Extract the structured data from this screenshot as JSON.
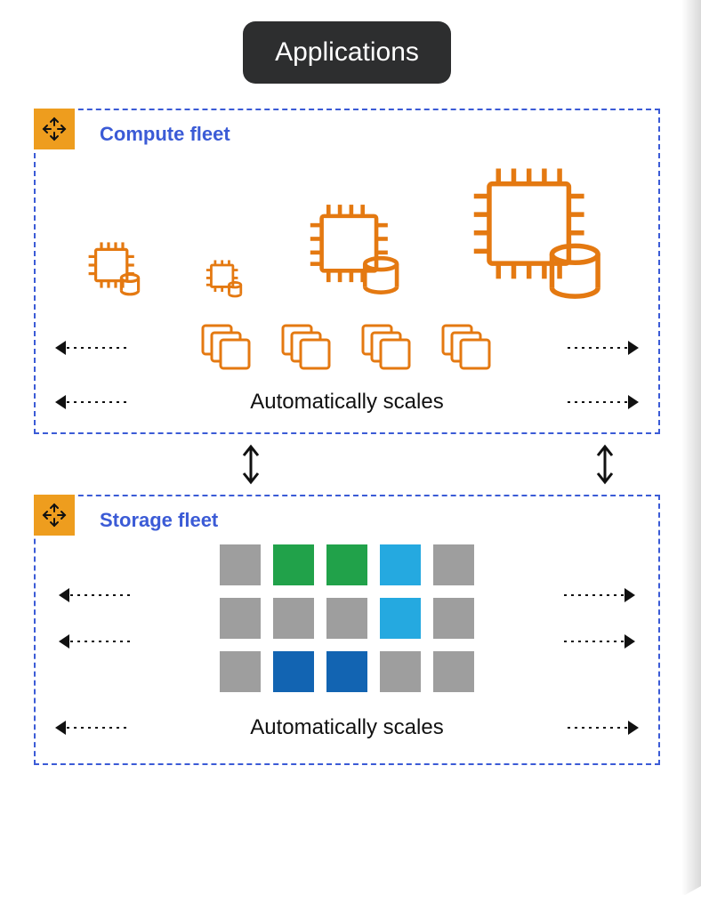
{
  "header": {
    "label": "Applications"
  },
  "compute": {
    "title": "Compute fleet",
    "scale_text": "Automatically scales"
  },
  "storage": {
    "title": "Storage fleet",
    "scale_text": "Automatically scales",
    "cells": [
      [
        "gray",
        "green",
        "green",
        "blue-light",
        "gray"
      ],
      [
        "gray",
        "gray",
        "gray",
        "blue-light",
        "gray"
      ],
      [
        "gray",
        "blue-dark",
        "blue-dark",
        "gray",
        "gray"
      ]
    ]
  }
}
